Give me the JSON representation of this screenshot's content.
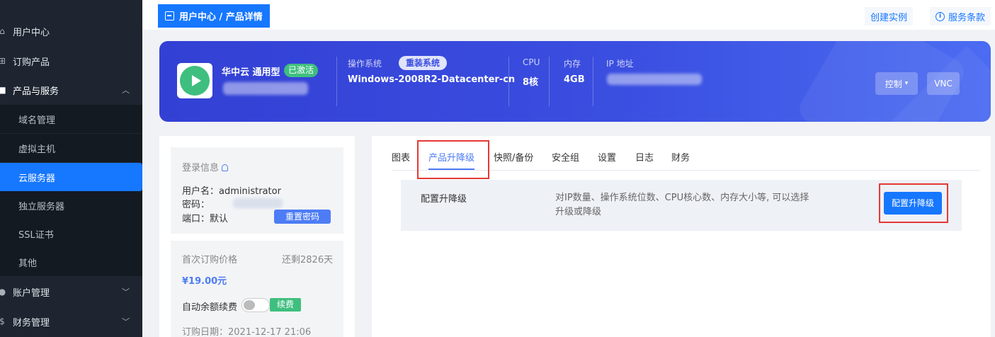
{
  "sidebar": {
    "items": [
      {
        "label": "用户中心",
        "icon": "home-icon"
      },
      {
        "label": "订购产品",
        "icon": "grid-icon"
      },
      {
        "label": "产品与服务",
        "icon": "apps-icon"
      },
      {
        "label": "域名管理"
      },
      {
        "label": "虚拟主机"
      },
      {
        "label": "云服务器"
      },
      {
        "label": "独立服务器"
      },
      {
        "label": "SSL证书"
      },
      {
        "label": "其他"
      },
      {
        "label": "账户管理",
        "icon": "user-icon"
      },
      {
        "label": "财务管理",
        "icon": "money-icon"
      }
    ]
  },
  "topbar": {
    "breadcrumb": "用户中心 / 产品详情",
    "create_instance": "创建实例",
    "terms": "服务条款"
  },
  "banner": {
    "product_name": "华中云 通用型",
    "status": "已激活",
    "os_label": "操作系统",
    "reinstall": "重装系统",
    "os_value": "Windows-2008R2-Datacenter-cn",
    "cpu_label": "CPU",
    "cpu_value": "8核",
    "mem_label": "内存",
    "mem_value": "4GB",
    "ip_label": "IP 地址",
    "control": "控制",
    "vnc": "VNC"
  },
  "login": {
    "title": "登录信息",
    "username": "用户名：administrator",
    "password": "密码：",
    "port": "端口：默认",
    "reset": "重置密码"
  },
  "order": {
    "price_label": "首次订购价格",
    "remaining": "还剩2826天",
    "price": "¥19.00元",
    "auto_renew": "自动余额续费",
    "renew": "续费",
    "date": "订购日期：2021-12-17 21:06"
  },
  "tabs": [
    "图表",
    "产品升降级",
    "快照/备份",
    "安全组",
    "设置",
    "日志",
    "财务"
  ],
  "upgrade": {
    "title": "配置升降级",
    "desc": "对IP数量、操作系统位数、CPU核心数、内存大小等, 可以选择升级或降级",
    "button": "配置升降级"
  },
  "colors": {
    "accent": "#1677ff",
    "banner": "#3a4ee0",
    "success": "#3fbf7f",
    "highlight_border": "#e53935"
  }
}
